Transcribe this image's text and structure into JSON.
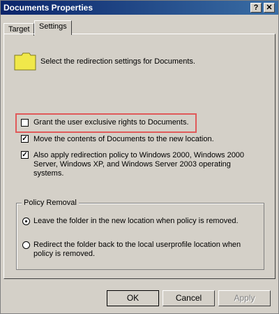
{
  "window": {
    "title": "Documents Properties",
    "help_label": "?",
    "close_label": "✕"
  },
  "tabs": [
    {
      "label": "Target",
      "selected": false
    },
    {
      "label": "Settings",
      "selected": true
    }
  ],
  "settings": {
    "intro_text": "Select the redirection settings for Documents.",
    "checkboxes": [
      {
        "label": "Grant the user exclusive rights to Documents.",
        "checked": false
      },
      {
        "label": "Move the contents of Documents to the new location.",
        "checked": true
      },
      {
        "lines": [
          "Also apply redirection policy to Windows 2000, Windows 2000",
          "Server, Windows XP, and Windows Server 2003 operating",
          "systems."
        ],
        "checked": true
      }
    ],
    "policy_removal": {
      "title": "Policy Removal",
      "options": [
        {
          "lines": [
            "Leave the folder in the new location when policy is removed."
          ],
          "selected": true
        },
        {
          "lines": [
            "Redirect the folder back to the local userprofile location when",
            "policy is removed."
          ],
          "selected": false
        }
      ]
    }
  },
  "buttons": {
    "ok_label": "OK",
    "cancel_label": "Cancel",
    "apply_label": "Apply"
  },
  "colors": {
    "highlight": "#e05a5a",
    "folder": "#f0e84a"
  }
}
